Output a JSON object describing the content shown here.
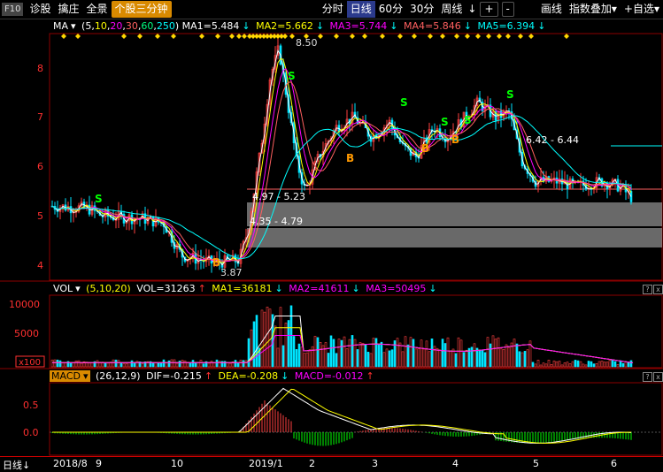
{
  "toolbar": {
    "f10": "F10",
    "items": [
      "诊股",
      "擒庄",
      "全景"
    ],
    "active_tab": "个股三分钟",
    "periods": [
      "分时",
      "日线",
      "60分",
      "30分",
      "周线"
    ],
    "active_period": "日线",
    "period_more": "↓",
    "plus": "+",
    "minus": "-",
    "right_items": [
      "画线",
      "指数叠加",
      "+自选"
    ],
    "right_arrows": [
      "▾",
      "▾"
    ]
  },
  "colors": {
    "ma1": "#ffffff",
    "ma2": "#ffff00",
    "ma3": "#ff00ff",
    "ma4": "#ff6060",
    "ma5": "#00ffff",
    "up": "#ff4040",
    "down": "#00e5ff",
    "grid": "#8b0000",
    "axis_text": "#ff3030",
    "buy": "#ff9900",
    "sell": "#00ff00"
  },
  "ma_line": {
    "label": "MA",
    "params_open": "(",
    "params": [
      "5",
      "10",
      "20",
      "30",
      "60",
      "250"
    ],
    "params_close": ")",
    "ma1": "MA1=5.484",
    "ma2": "MA2=5.662",
    "ma3": "MA3=5.744",
    "ma4": "MA4=5.846",
    "ma5": "MA5=6.394",
    "arrow_down": "↓"
  },
  "vol_line": {
    "label": "VOL",
    "params": "(5,10,20)",
    "vol": "VOL=31263",
    "ma1": "MA1=36181",
    "ma2": "MA2=41611",
    "ma3": "MA3=50495",
    "arrow_up": "↑",
    "arrow_down": "↓"
  },
  "macd_line": {
    "label": "MACD",
    "params": "(26,12,9)",
    "dif": "DIF=-0.215",
    "dea": "DEA=-0.208",
    "macd": "MACD=-0.012",
    "arrow_up": "↑",
    "arrow_down": "↓"
  },
  "price_axis": [
    "8",
    "7",
    "6",
    "5",
    "4"
  ],
  "vol_axis": [
    "10000",
    "5000",
    "x100"
  ],
  "macd_axis": [
    "0.5",
    "0.0"
  ],
  "annotations": {
    "high": "8.50",
    "low": "3.87",
    "range1": "4.35 - 4.79",
    "range2": "4.97 - 5.23",
    "range3": "6.42 - 6.44",
    "buy": "B",
    "sell": "S"
  },
  "bottom": {
    "period": "日线",
    "arrow": "↓",
    "dates": [
      "2018/8",
      "9",
      "10",
      "2019/1",
      "2",
      "3",
      "4",
      "5",
      "6"
    ]
  },
  "close_icon": "x"
}
